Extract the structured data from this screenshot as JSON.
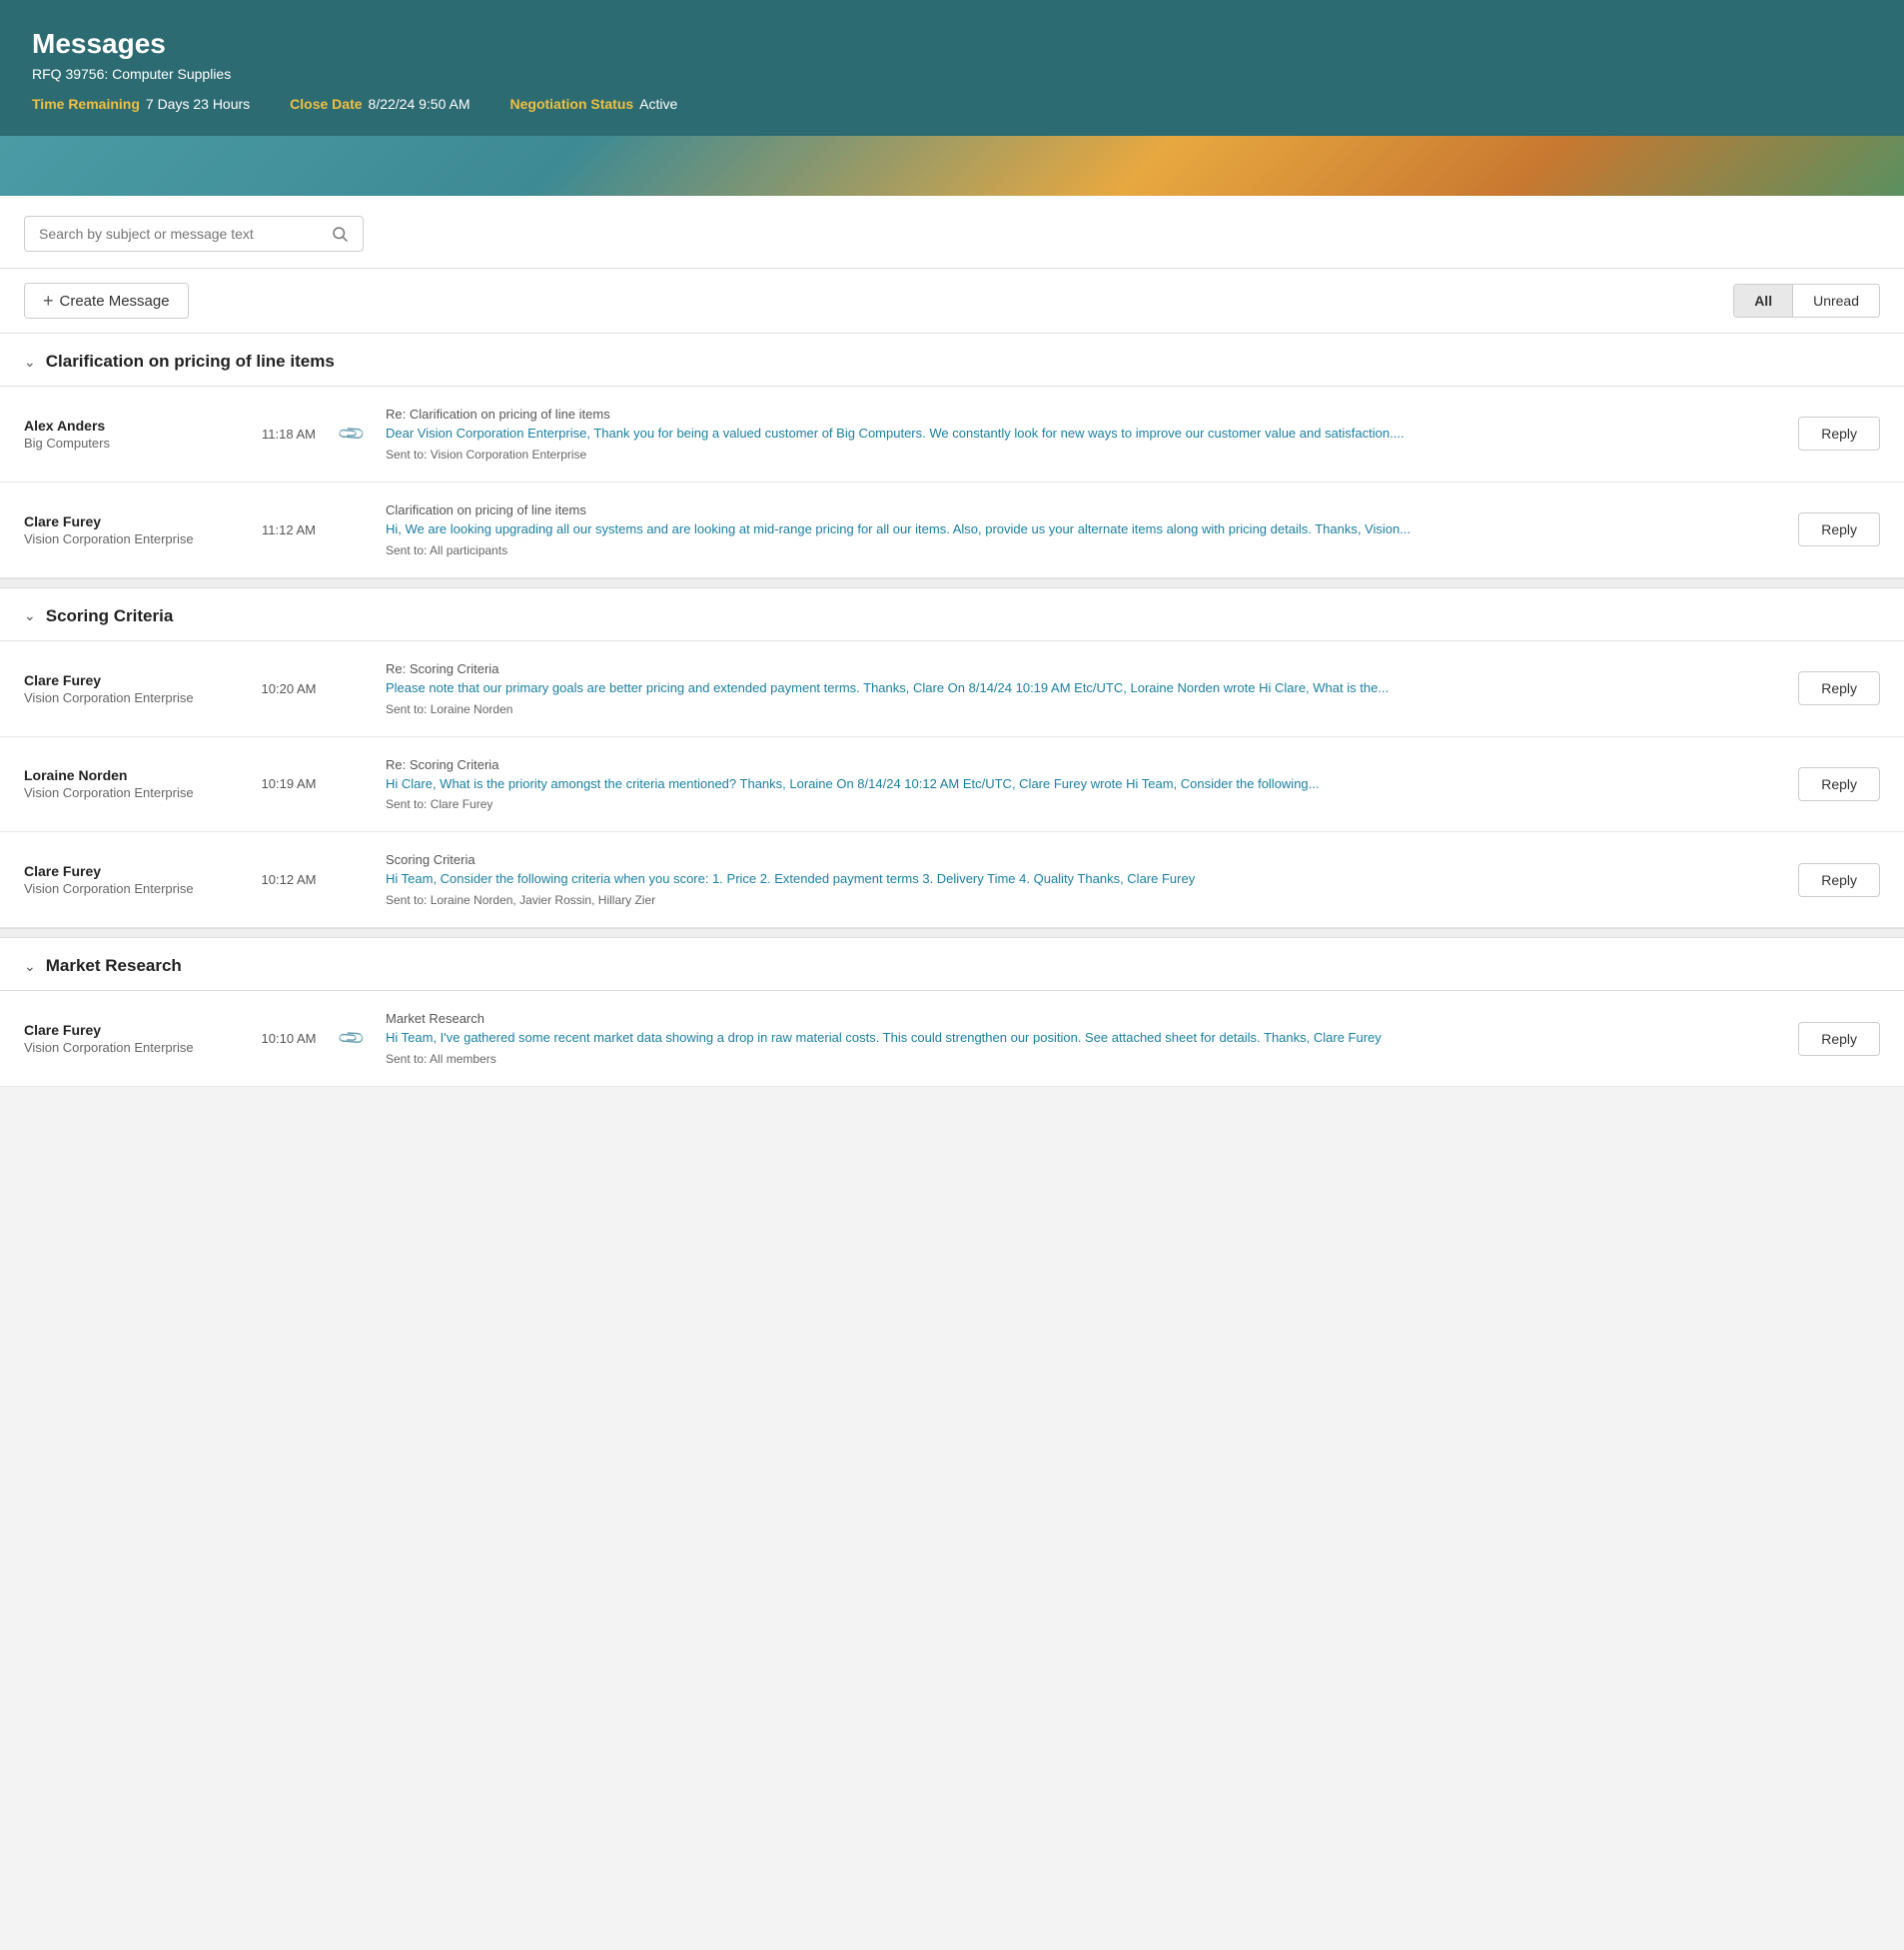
{
  "header": {
    "title": "Messages",
    "rfq": "RFQ 39756: Computer Supplies",
    "meta": [
      {
        "label": "Time Remaining",
        "value": "7 Days 23 Hours"
      },
      {
        "label": "Close Date",
        "value": "8/22/24 9:50 AM"
      },
      {
        "label": "Negotiation Status",
        "value": "Active"
      }
    ]
  },
  "search": {
    "placeholder": "Search by subject or message text"
  },
  "toolbar": {
    "create_label": "Create Message",
    "filter_all": "All",
    "filter_unread": "Unread"
  },
  "groups": [
    {
      "title": "Clarification on pricing of line items",
      "messages": [
        {
          "sender_name": "Alex Anders",
          "sender_org": "Big Computers",
          "time": "11:18 AM",
          "has_attachment": true,
          "subject": "Re: Clarification on pricing of line items",
          "preview": "Dear Vision Corporation Enterprise, Thank you for being a valued customer of Big Computers. We constantly look for new ways to improve our customer value and satisfaction....",
          "sent_to": "Sent to: Vision Corporation Enterprise"
        },
        {
          "sender_name": "Clare Furey",
          "sender_org": "Vision Corporation Enterprise",
          "time": "11:12 AM",
          "has_attachment": false,
          "subject": "Clarification on pricing of line items",
          "preview": "Hi, We are looking upgrading all our systems and are looking at mid-range pricing for all our items. Also, provide us your alternate items along with pricing details. Thanks, Vision...",
          "sent_to": "Sent to: All participants"
        }
      ]
    },
    {
      "title": "Scoring Criteria",
      "messages": [
        {
          "sender_name": "Clare Furey",
          "sender_org": "Vision Corporation Enterprise",
          "time": "10:20 AM",
          "has_attachment": false,
          "subject": "Re: Scoring Criteria",
          "preview": "Please note that our primary goals are better pricing and extended payment terms. Thanks, Clare On 8/14/24 10:19 AM Etc/UTC, Loraine Norden wrote Hi Clare, What is the...",
          "sent_to": "Sent to: Loraine Norden"
        },
        {
          "sender_name": "Loraine Norden",
          "sender_org": "Vision Corporation Enterprise",
          "time": "10:19 AM",
          "has_attachment": false,
          "subject": "Re: Scoring Criteria",
          "preview": "Hi Clare, What is the priority amongst the criteria mentioned? Thanks, Loraine On 8/14/24 10:12 AM Etc/UTC, Clare Furey wrote Hi Team, Consider the following...",
          "sent_to": "Sent to: Clare Furey"
        },
        {
          "sender_name": "Clare Furey",
          "sender_org": "Vision Corporation Enterprise",
          "time": "10:12 AM",
          "has_attachment": false,
          "subject": "Scoring Criteria",
          "preview": "Hi Team, Consider the following criteria when you score: 1. Price 2. Extended payment terms 3. Delivery Time 4. Quality Thanks, Clare Furey",
          "sent_to": "Sent to: Loraine Norden, Javier Rossin, Hillary Zier"
        }
      ]
    },
    {
      "title": "Market Research",
      "messages": [
        {
          "sender_name": "Clare Furey",
          "sender_org": "Vision Corporation Enterprise",
          "time": "10:10 AM",
          "has_attachment": true,
          "subject": "Market Research",
          "preview": "Hi Team, I've gathered some recent market data showing a drop in raw material costs. This could strengthen our position. See attached sheet for details. Thanks, Clare Furey",
          "sent_to": "Sent to: All members"
        }
      ]
    }
  ],
  "reply_label": "Reply"
}
